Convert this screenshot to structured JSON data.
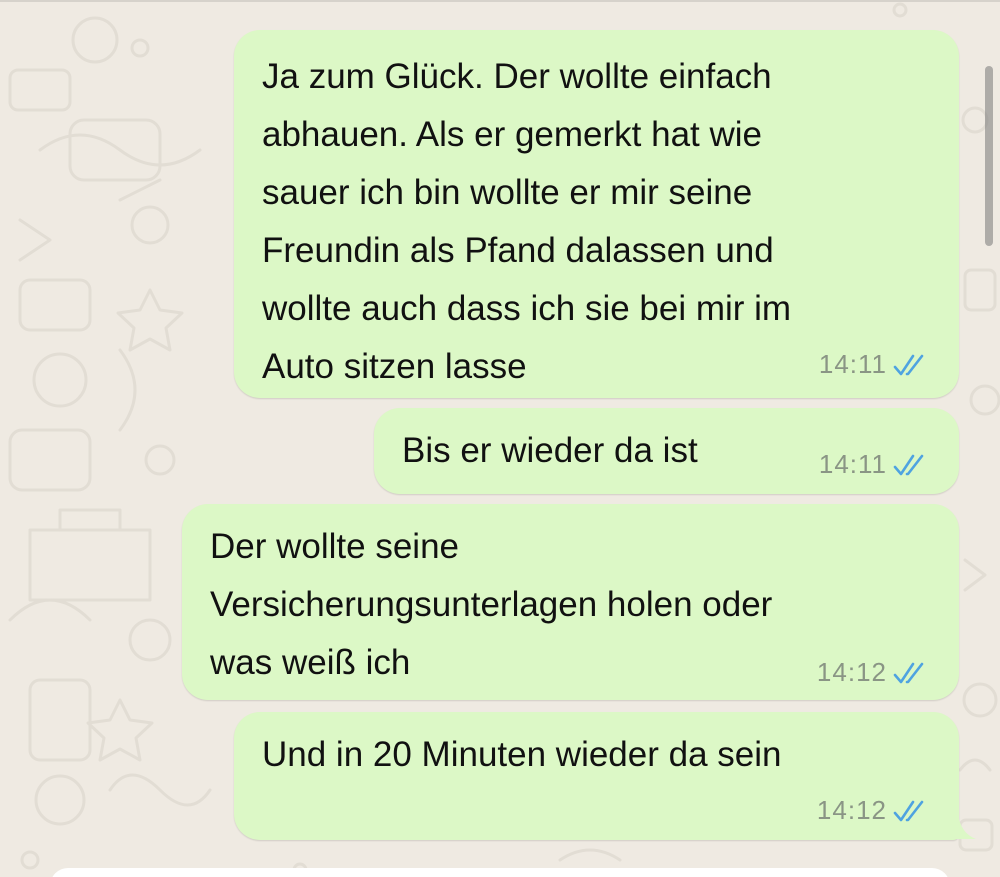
{
  "colors": {
    "background": "#efeae2",
    "outgoing_bubble": "#dcf8c6",
    "read_ticks": "#4fa3e0",
    "timestamp": "#8a9585"
  },
  "messages": [
    {
      "text": "Ja zum Glück. Der wollte einfach\nabhauen. Als er gemerkt hat wie\nsauer ich bin wollte er mir seine\nFreundin als Pfand dalassen und\nwollte auch dass ich sie bei mir im\nAuto sitzen lasse",
      "time": "14:11",
      "status": "read-double-check-icon"
    },
    {
      "text": "Bis er wieder da ist",
      "time": "14:11",
      "status": "read-double-check-icon"
    },
    {
      "text": "Der wollte seine\nVersicherungsunterlagen holen oder\nwas weiß ich",
      "time": "14:12",
      "status": "read-double-check-icon"
    },
    {
      "text": "Und in 20 Minuten wieder da sein",
      "time": "14:12",
      "status": "read-double-check-icon"
    }
  ]
}
